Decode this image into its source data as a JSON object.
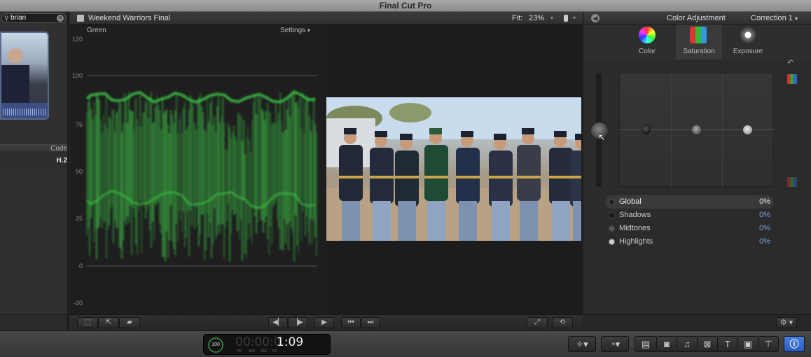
{
  "app": {
    "title": "Final Cut Pro"
  },
  "browser": {
    "search_value": "brian",
    "column_header": "Code",
    "row_codec": "H.2"
  },
  "viewer": {
    "project_title": "Weekend Warriors Final",
    "fit_label": "Fit:",
    "fit_value": "23%",
    "scope_channel": "Green",
    "scope_settings": "Settings",
    "scope_ticks": [
      "120",
      "100",
      "75",
      "50",
      "25",
      "0",
      "-20"
    ]
  },
  "inspector": {
    "title": "Color Adjustment",
    "correction": "Correction 1",
    "tabs": [
      {
        "label": "Color",
        "icon": "color-wheel-icon"
      },
      {
        "label": "Saturation",
        "icon": "saturation-icon"
      },
      {
        "label": "Exposure",
        "icon": "exposure-icon"
      }
    ],
    "active_tab": "Saturation",
    "controls": [
      {
        "name": "Global",
        "value": "0%"
      },
      {
        "name": "Shadows",
        "value": "0%"
      },
      {
        "name": "Midtones",
        "value": "0%"
      },
      {
        "name": "Highlights",
        "value": "0%"
      }
    ]
  },
  "dashboard": {
    "percent": "100",
    "timecode_dim": "00:00:0",
    "timecode_lit": "1:09",
    "units": [
      "HR",
      "MIN",
      "SEC",
      "FR"
    ]
  },
  "colors": {
    "waveform": "#3fd24a",
    "accent_blue": "#2a6bd8"
  }
}
